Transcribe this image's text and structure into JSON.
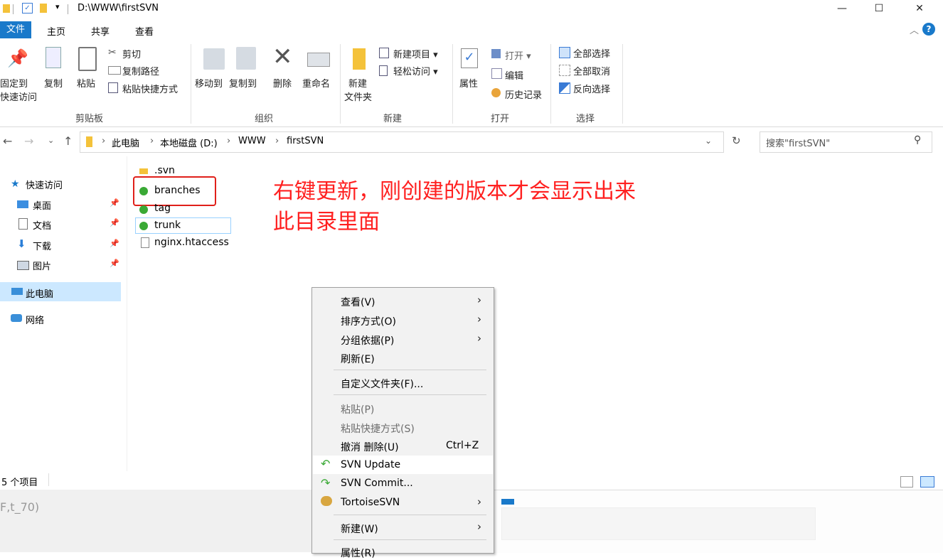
{
  "titlebar": {
    "path": "D:\\WWW\\firstSVN",
    "minimize": "—",
    "maximize": "☐",
    "close": "✕"
  },
  "tabs": {
    "file": "文件",
    "home": "主页",
    "share": "共享",
    "view": "查看"
  },
  "ribbon": {
    "pin": "固定到",
    "pin2": "快速访问",
    "copy": "复制",
    "paste": "粘贴",
    "cut": "剪切",
    "copy_path": "复制路径",
    "paste_shortcut": "粘贴快捷方式",
    "clipboard": "剪贴板",
    "move_to": "移动到",
    "copy_to": "复制到",
    "delete": "删除",
    "rename": "重命名",
    "organize": "组织",
    "new_folder1": "新建",
    "new_folder2": "文件夹",
    "new_item": "新建项目 ▾",
    "easy_access": "轻松访问 ▾",
    "new": "新建",
    "properties": "属性",
    "open": "打开 ▾",
    "edit": "编辑",
    "history": "历史记录",
    "open_group": "打开",
    "select_all": "全部选择",
    "select_none": "全部取消",
    "invert": "反向选择",
    "select_group": "选择"
  },
  "address": {
    "crumbs": [
      "此电脑",
      "本地磁盘 (D:)",
      "WWW",
      "firstSVN"
    ],
    "sep": "›",
    "search_placeholder": "搜索\"firstSVN\""
  },
  "nav": {
    "quick": "快速访问",
    "desktop": "桌面",
    "docs": "文档",
    "downloads": "下载",
    "pictures": "图片",
    "this_pc": "此电脑",
    "network": "网络"
  },
  "files": [
    ".svn",
    "branches",
    "tag",
    "trunk",
    "nginx.htaccess"
  ],
  "annotation": {
    "line1": "右键更新，刚创建的版本才会显示出来",
    "line2": "此目录里面"
  },
  "status": {
    "count": "5 个项目",
    "fragment": "F,t_70)"
  },
  "menu": {
    "view": "查看(V)",
    "sort": "排序方式(O)",
    "group": "分组依据(P)",
    "refresh": "刷新(E)",
    "customize": "自定义文件夹(F)...",
    "paste": "粘贴(P)",
    "paste_shortcut": "粘贴快捷方式(S)",
    "undo": "撤消 删除(U)",
    "undo_key": "Ctrl+Z",
    "svn_update": "SVN Update",
    "svn_commit": "SVN Commit...",
    "tortoise": "TortoiseSVN",
    "new": "新建(W)",
    "props": "属性(R)"
  },
  "colors": {
    "accent": "#1979ca",
    "annotation": "#ff2020",
    "svn_green": "#3aa935",
    "folder": "#f4c23a"
  }
}
